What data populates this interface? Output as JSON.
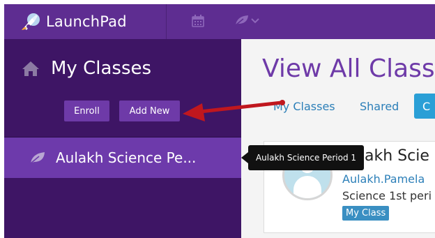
{
  "app": {
    "name": "LaunchPad"
  },
  "topbar": {
    "icons": [
      "launchpad-logo-icon",
      "calendar-icon",
      "leaf-icon",
      "chevron-down-icon"
    ]
  },
  "sidebar": {
    "title": "My Classes",
    "buttons": {
      "enroll": "Enroll",
      "add_new": "Add New"
    },
    "items": [
      {
        "label": "Aulakh Science Pe...",
        "icon": "leaf-icon"
      }
    ]
  },
  "main": {
    "title": "View All Class",
    "tabs": [
      {
        "label": "My Classes"
      },
      {
        "label": "Shared"
      },
      {
        "label": "C",
        "active": true
      }
    ],
    "card": {
      "title": "ulakh Scie",
      "teacher": "Aulakh.Pamela",
      "description": "Science 1st peri",
      "badge": "My Class"
    }
  },
  "tooltip": {
    "text": "Aulakh Science Period 1"
  },
  "colors": {
    "topbar": "#5e2d91",
    "sidebar": "#3e1565",
    "accent_purple": "#6e3aa8",
    "link_blue": "#2c7fb8",
    "annotation_red": "#c0171e"
  }
}
